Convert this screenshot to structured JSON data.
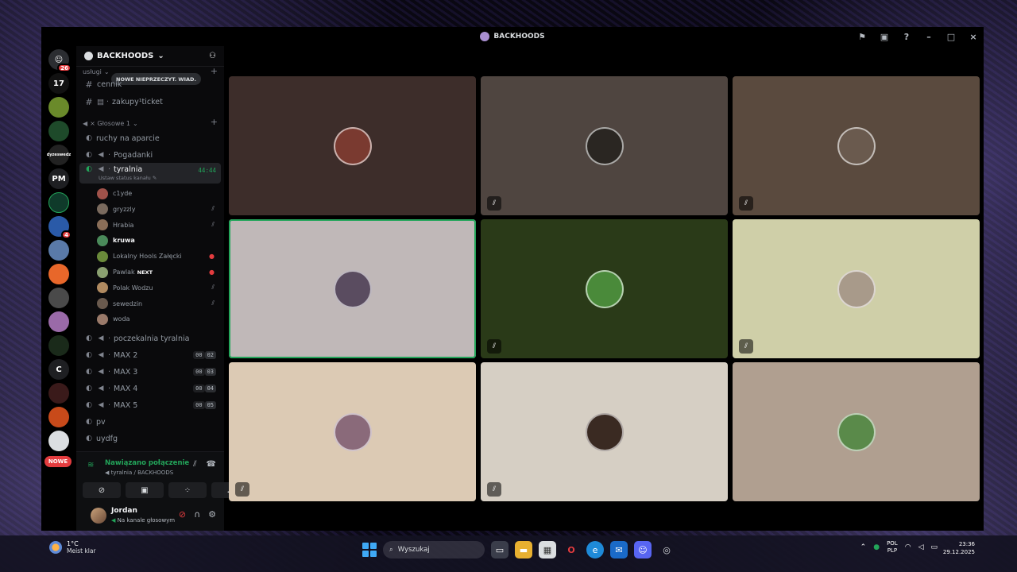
{
  "window": {
    "title": "BACKHOODS"
  },
  "rail": {
    "home_badge": "26",
    "items": [
      {
        "label": "",
        "color": "#000000"
      },
      {
        "label": "PM",
        "color": "#1e1f22"
      },
      {
        "label": "C",
        "color": "#1e1f22"
      }
    ],
    "small_badge": "4",
    "nowe_label": "NOWE"
  },
  "sidebar": {
    "guild_name": "BACKHOODS",
    "tooltip_new": "NOWE NIEPRZECZYT. WIAD.",
    "category_top": "usługi",
    "text_channels": [
      "cennik",
      "zakupy¹ticket"
    ],
    "voice_category": "× Głosowe 1",
    "voice_channels_before": [
      "ruchy na aparcie",
      "Pogadanki"
    ],
    "active_channel": {
      "name": "tyralnia",
      "timer": "44:44",
      "status": "Ustaw status kanału"
    },
    "members": [
      {
        "name": "c1yde",
        "mute": "",
        "bold": false,
        "color": "#a0524a"
      },
      {
        "name": "gryzzly",
        "mute": "muted",
        "bold": false,
        "color": "#7a6a5e"
      },
      {
        "name": "Hrabia",
        "mute": "muted",
        "bold": false,
        "color": "#8a6e58"
      },
      {
        "name": "kruwa",
        "mute": "",
        "bold": true,
        "color": "#4a8a5a"
      },
      {
        "name": "Lokalny Hools Załęcki",
        "mute": "red",
        "bold": false,
        "color": "#6a8a3a"
      },
      {
        "name": "Pawlak",
        "mute": "red",
        "bold": false,
        "color": "#8aa070",
        "tag": "NEXT"
      },
      {
        "name": "Polak Wodzu",
        "mute": "muted",
        "bold": false,
        "color": "#b08a60"
      },
      {
        "name": "sewedzin",
        "mute": "muted",
        "bold": false,
        "color": "#6a5a4e"
      },
      {
        "name": "woda",
        "mute": "",
        "bold": false,
        "color": "#9a7a6a"
      }
    ],
    "voice_channels_after": [
      {
        "name": "poczekalnia tyralnia",
        "counts": null
      },
      {
        "name": "MAX 2",
        "counts": [
          "00",
          "02"
        ]
      },
      {
        "name": "MAX 3",
        "counts": [
          "00",
          "03"
        ]
      },
      {
        "name": "MAX 4",
        "counts": [
          "00",
          "04"
        ]
      },
      {
        "name": "MAX 5",
        "counts": [
          "00",
          "05"
        ]
      },
      {
        "name": "pv",
        "counts": null
      },
      {
        "name": "uydfg",
        "counts": null
      }
    ]
  },
  "voice_panel": {
    "status": "Nawiązano połączenie",
    "location": "tyralnia / BACKHOODS"
  },
  "user_panel": {
    "name": "Jordan",
    "status": "Na kanale głosowym"
  },
  "tiles": [
    {
      "bg": "#3d2d2a",
      "muted": false,
      "speaking": false,
      "avatar": "#7a3a30"
    },
    {
      "bg": "#4f4540",
      "muted": true,
      "speaking": false,
      "avatar": "#2a2622"
    },
    {
      "bg": "#5a4a3e",
      "muted": true,
      "speaking": false,
      "avatar": "#6a5a4e"
    },
    {
      "bg": "#c0b8b8",
      "muted": false,
      "speaking": true,
      "avatar": "#5a4c60"
    },
    {
      "bg": "#2a3a18",
      "muted": true,
      "speaking": false,
      "avatar": "#4a8a3a"
    },
    {
      "bg": "#cfcfa8",
      "muted": true,
      "speaking": false,
      "avatar": "#a89a8a"
    },
    {
      "bg": "#dccab4",
      "muted": true,
      "speaking": false,
      "avatar": "#8a6a7a"
    },
    {
      "bg": "#d6cfc4",
      "muted": true,
      "speaking": false,
      "avatar": "#3a2a22"
    },
    {
      "bg": "#b09f90",
      "muted": false,
      "speaking": false,
      "avatar": "#5a8a4a"
    }
  ],
  "taskbar": {
    "temp": "1°C",
    "weather": "Meist klar",
    "search": "Wyszukaj",
    "lang1": "POL",
    "lang2": "PLP",
    "time": "23:36",
    "date": "29.12.2025"
  }
}
